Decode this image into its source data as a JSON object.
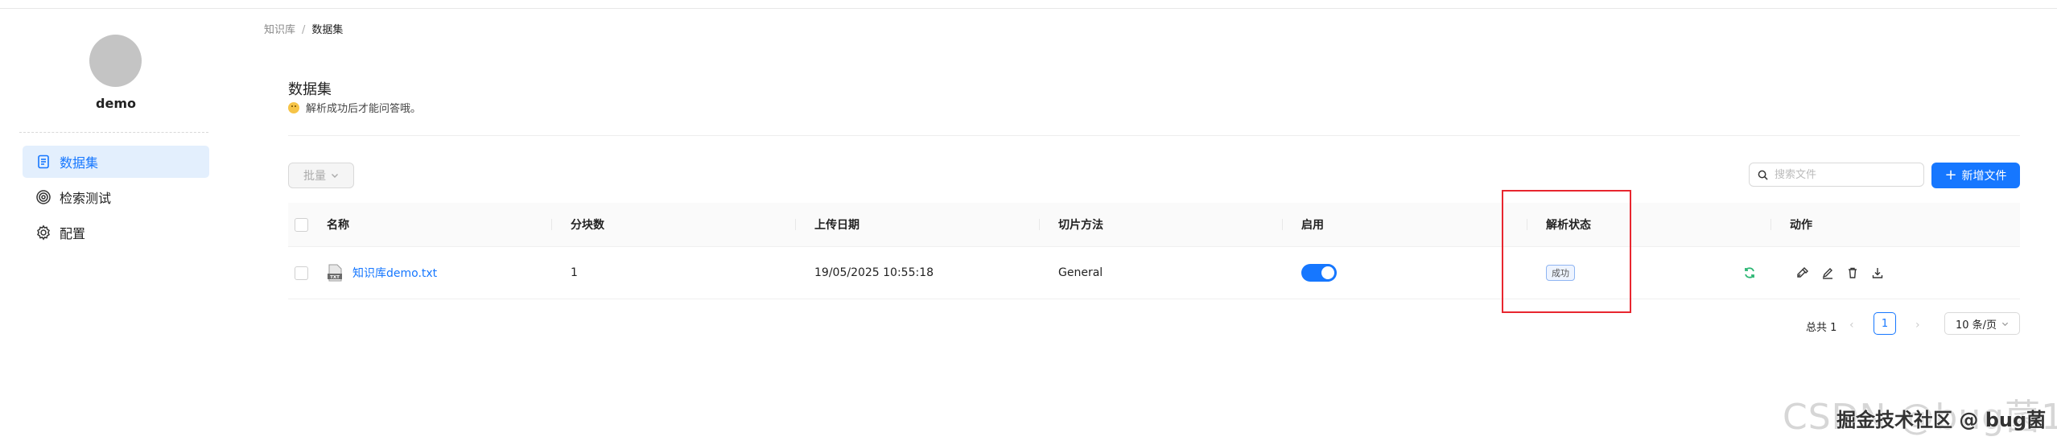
{
  "user": {
    "name": "demo"
  },
  "sidebar": {
    "items": [
      {
        "label": "数据集",
        "icon": "document-icon",
        "active": true
      },
      {
        "label": "检索测试",
        "icon": "target-icon",
        "active": false
      },
      {
        "label": "配置",
        "icon": "gear-icon",
        "active": false
      }
    ]
  },
  "breadcrumb": {
    "root": "知识库",
    "separator": "/",
    "current": "数据集"
  },
  "header": {
    "title": "数据集",
    "subtitle": "解析成功后才能问答哦。"
  },
  "toolbar": {
    "bulk_label": "批量",
    "search_placeholder": "搜索文件",
    "add_label": "新增文件"
  },
  "table": {
    "columns": [
      "名称",
      "分块数",
      "上传日期",
      "切片方法",
      "启用",
      "解析状态",
      "动作"
    ],
    "rows": [
      {
        "name": "知识库demo.txt",
        "file_badge": "TXT",
        "chunks": "1",
        "upload_date": "19/05/2025 10:55:18",
        "method": "General",
        "enabled": true,
        "status": "成功"
      }
    ]
  },
  "pagination": {
    "total": "总共 1",
    "current": "1",
    "page_size": "10 条/页"
  },
  "watermark": {
    "outer": "CSDN @bug菌1",
    "inner": "掘金技术社区 @ bug菌"
  },
  "colors": {
    "accent": "#1677ff",
    "highlight": "#e8262f",
    "success_icon": "#2bb673"
  }
}
